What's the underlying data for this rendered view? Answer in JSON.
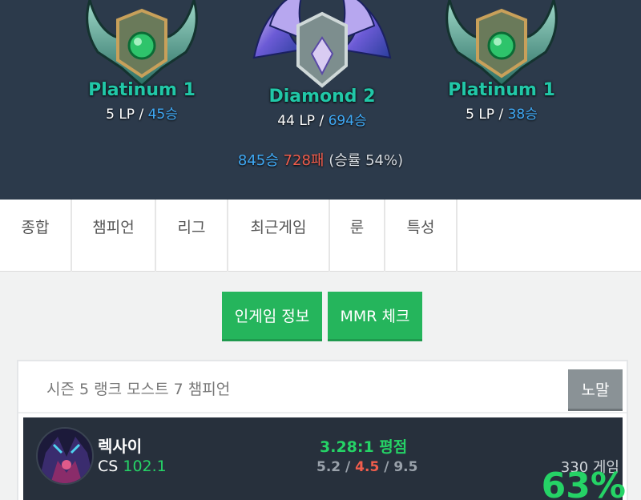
{
  "ranks": [
    {
      "name": "Platinum 1",
      "lp": "5 LP / ",
      "wins": "45승"
    },
    {
      "name": "Diamond 2",
      "lp": "44 LP / ",
      "wins": "694승"
    },
    {
      "name": "Platinum 1",
      "lp": "5 LP / ",
      "wins": "38승"
    }
  ],
  "summary": {
    "wins": "845승",
    "losses": "728패",
    "rate": "(승률 54%)"
  },
  "tabs": [
    "종합",
    "챔피언",
    "리그",
    "최근게임",
    "룬",
    "특성"
  ],
  "buttons": {
    "ingame": "인게임 정보",
    "mmr": "MMR 체크"
  },
  "card": {
    "title": "시즌 5 랭크 모스트 7 챔피언",
    "filter_label": "노말",
    "champion": {
      "name": "렉사이",
      "cs_label": "CS",
      "cs_value": "102.1",
      "kda_ratio": "3.28:1 평점",
      "kills": "5.2",
      "deaths": "4.5",
      "assists": "9.5",
      "games": "330 게임",
      "winrate": "63%"
    }
  },
  "colors": {
    "header_bg": "#2c3a4b",
    "accent_green": "#25b55c",
    "win_blue": "#3fa9f5",
    "loss_red": "#f25d4c"
  }
}
